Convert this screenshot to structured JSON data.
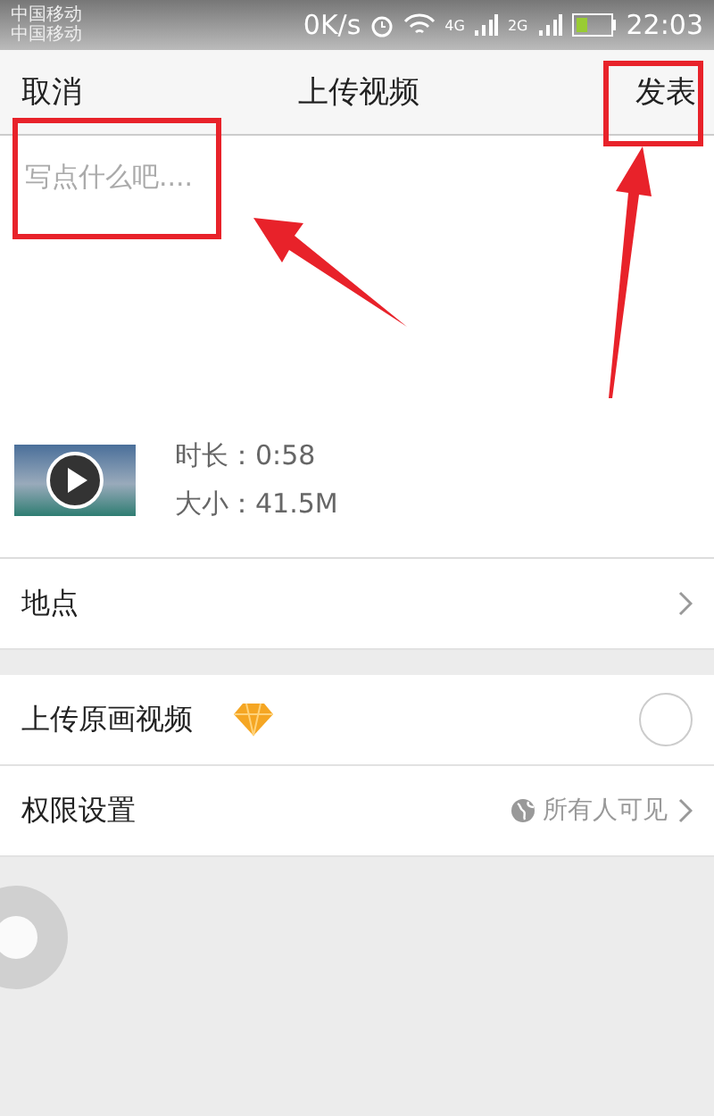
{
  "status_bar": {
    "carriers": [
      "中国移动",
      "中国移动"
    ],
    "speed": "0K/s",
    "network_labels": [
      "4G",
      "2G"
    ],
    "time": "22:03"
  },
  "nav": {
    "cancel": "取消",
    "title": "上传视频",
    "publish": "发表"
  },
  "compose": {
    "placeholder": "写点什么吧...."
  },
  "video": {
    "duration": "时长：0:58",
    "size": "大小：41.5M"
  },
  "location": {
    "label": "地点"
  },
  "original_video": {
    "label": "上传原画视频",
    "on": false
  },
  "permission": {
    "label": "权限设置",
    "value": "所有人可见"
  }
}
